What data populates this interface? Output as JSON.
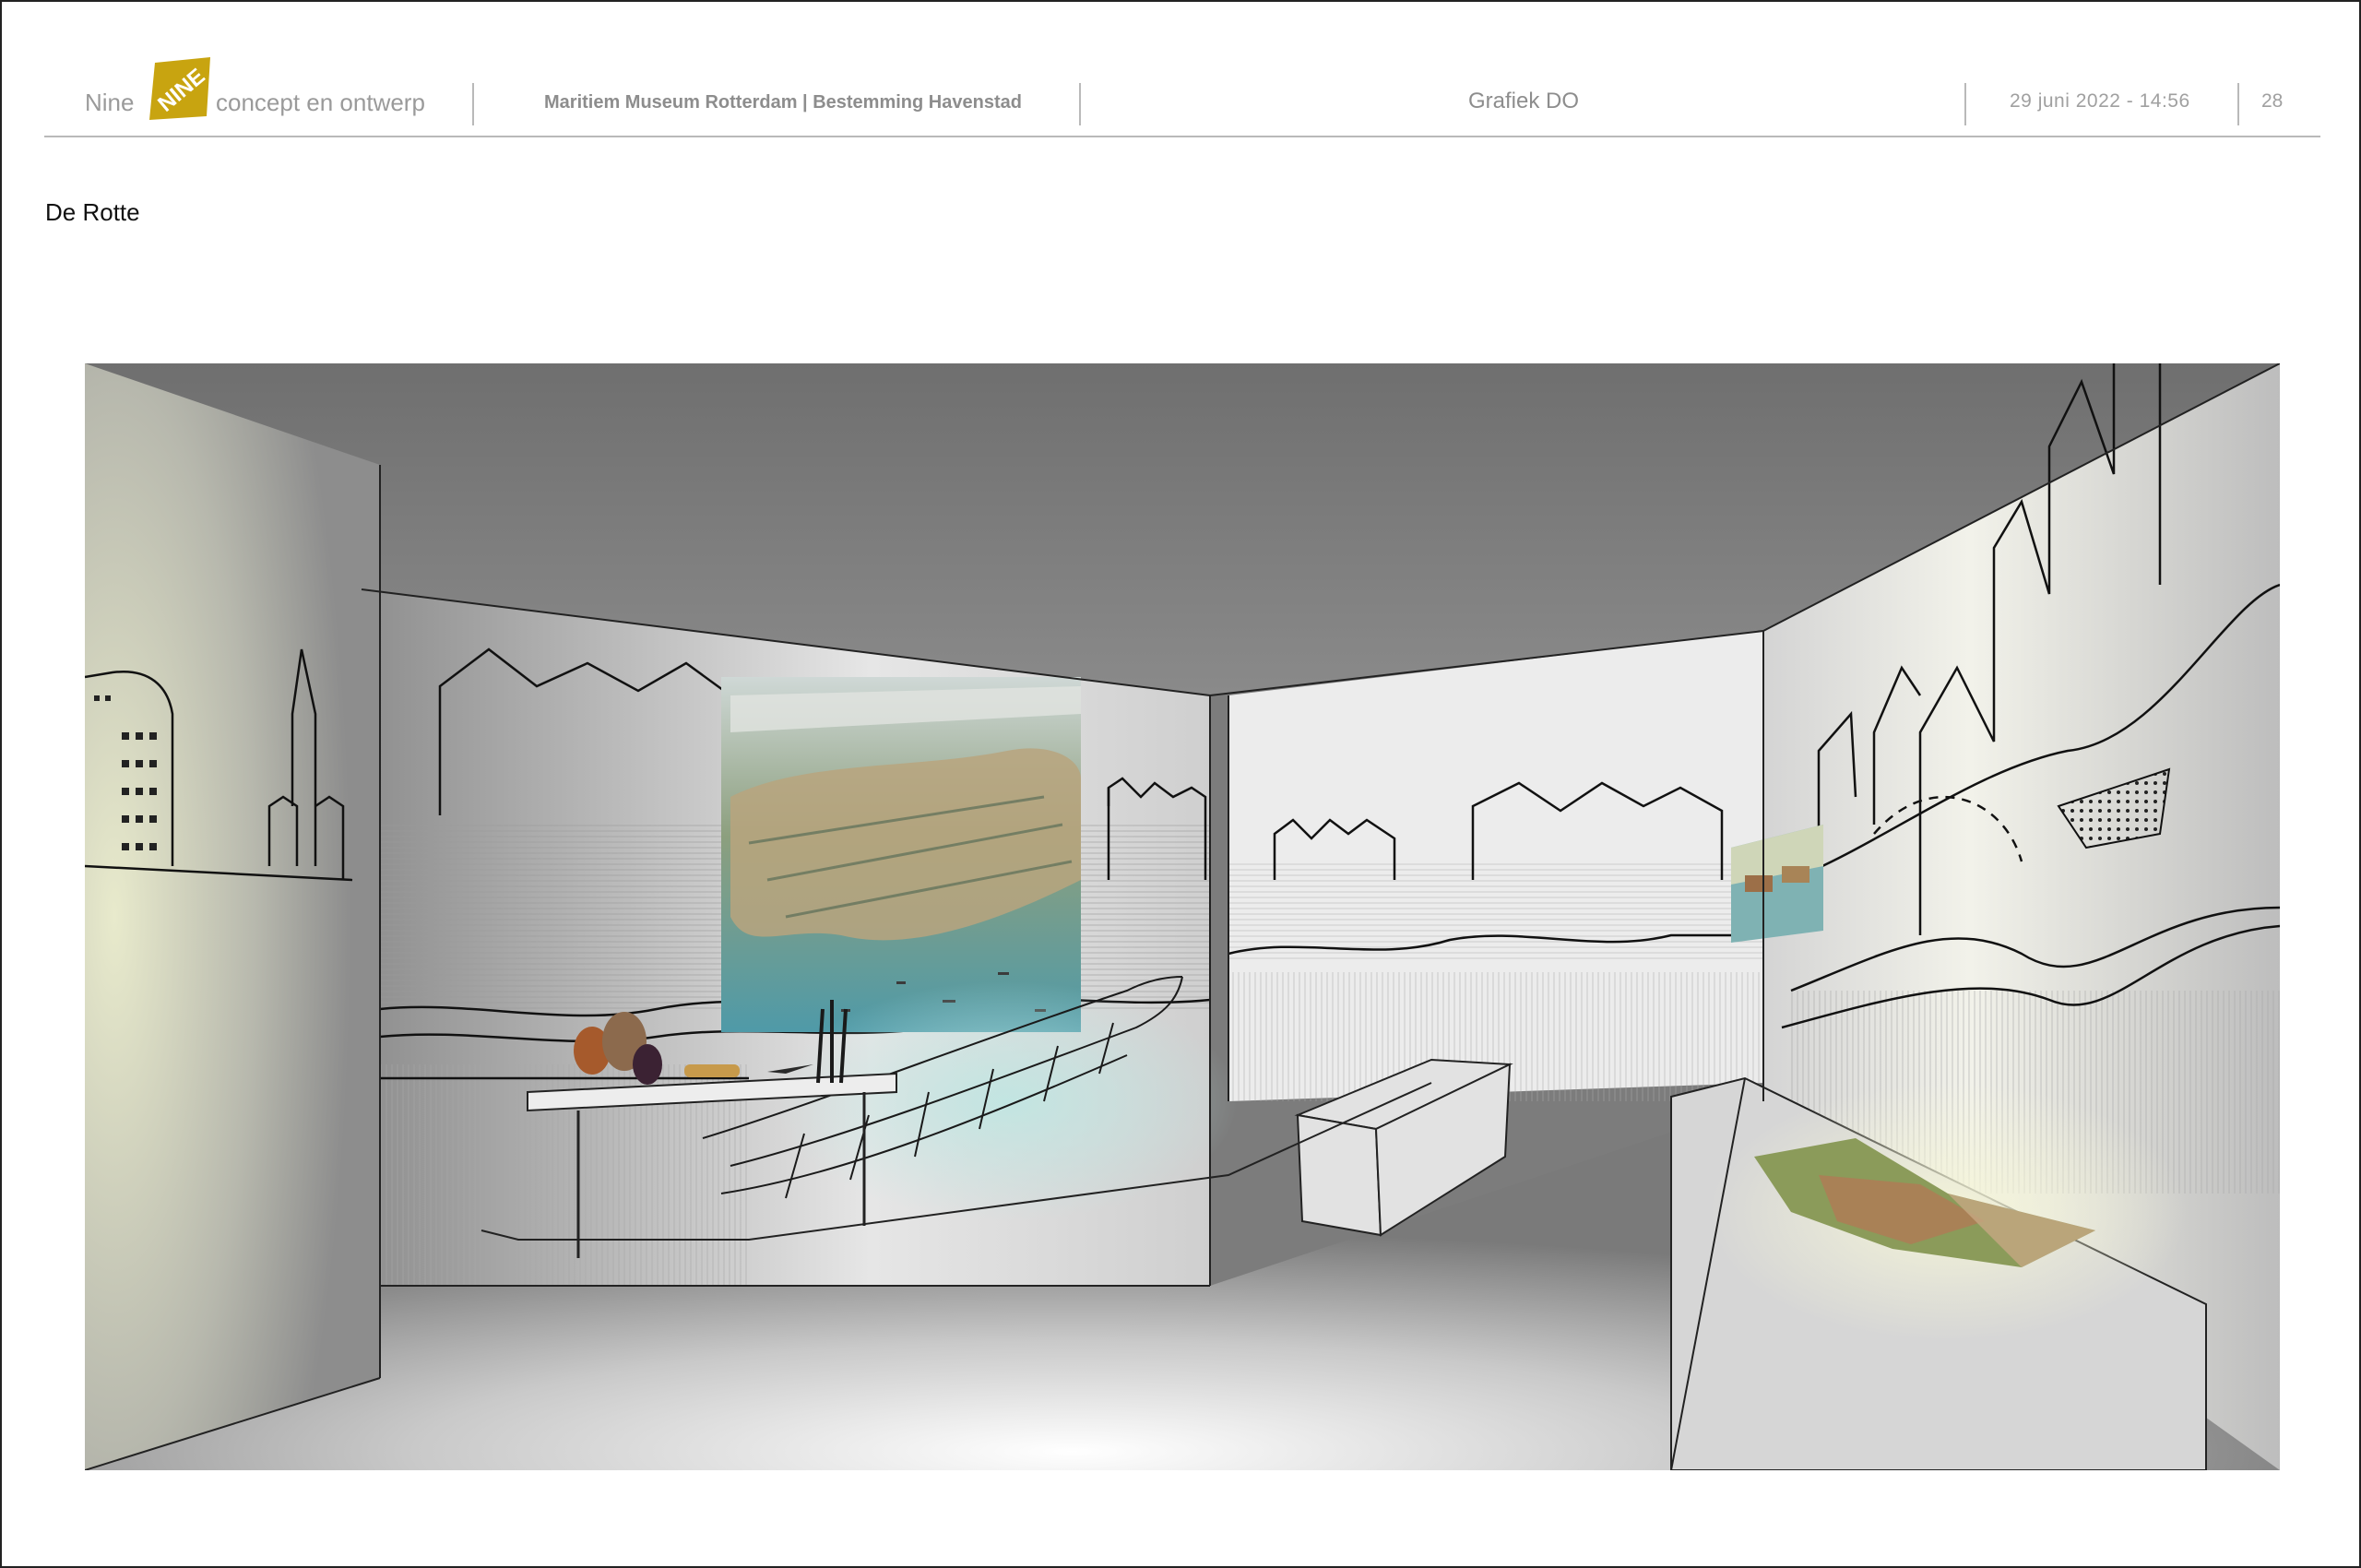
{
  "header": {
    "brand_pre": "Nine",
    "brand_logo_text": "NINE",
    "brand_post": "concept en ontwerp",
    "project": "Maritiem Museum Rotterdam | Bestemming Havenstad",
    "doc_title": "Grafiek DO",
    "date_time": "29  juni  2022  -  14:56",
    "page_number": "28"
  },
  "section": {
    "title": "De Rotte"
  },
  "colors": {
    "logo_gold": "#c8a410",
    "header_text": "#8d8d8d",
    "rule": "#b9b9b9"
  }
}
